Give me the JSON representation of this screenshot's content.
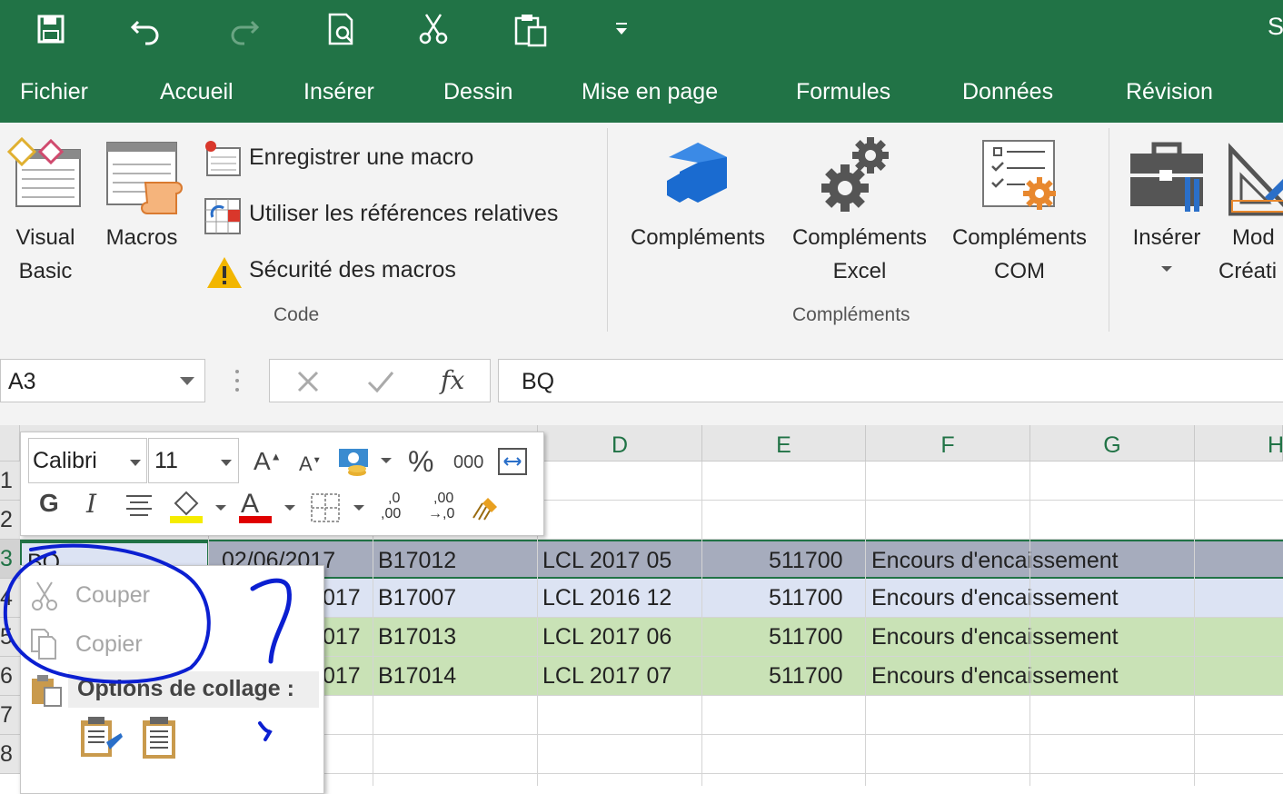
{
  "window": {
    "title_fragment": "S"
  },
  "ribbon_tabs": [
    "Fichier",
    "Accueil",
    "Insérer",
    "Dessin",
    "Mise en page",
    "Formules",
    "Données",
    "Révision"
  ],
  "ribbon": {
    "code_group": {
      "label": "Code",
      "visual_basic": [
        "Visual",
        "Basic"
      ],
      "macros": "Macros",
      "record_macro": "Enregistrer une macro",
      "relative_refs": "Utiliser les références relatives",
      "macro_security": "Sécurité des macros"
    },
    "addins_group": {
      "label": "Compléments",
      "addins": "Compléments",
      "excel_addins": [
        "Compléments",
        "Excel"
      ],
      "com_addins": [
        "Compléments",
        "COM"
      ]
    },
    "controls_group": {
      "insert": "Insérer",
      "design_mode": [
        "Mod",
        "Créati"
      ]
    }
  },
  "formula_bar": {
    "name_box": "A3",
    "fx": "fx",
    "formula": "BQ"
  },
  "columns": [
    "D",
    "E",
    "F",
    "G",
    "H"
  ],
  "rows": [
    {
      "num": "1",
      "cells": []
    },
    {
      "num": "2",
      "cells": []
    },
    {
      "num": "3",
      "a": "BQ",
      "b": "02/06/2017",
      "c": "B17012",
      "d": "LCL 2017 05",
      "e": "511700",
      "f": "Encours d'encaissement"
    },
    {
      "num": "4",
      "b": "017",
      "c": "B17007",
      "d": "LCL 2016 12",
      "e": "511700",
      "f": "Encours d'encaissement"
    },
    {
      "num": "5",
      "b": "017",
      "c": "B17013",
      "d": "LCL 2017 06",
      "e": "511700",
      "f": "Encours d'encaissement"
    },
    {
      "num": "6",
      "b": "017",
      "c": "B17014",
      "d": "LCL 2017 07",
      "e": "511700",
      "f": "Encours d'encaissement"
    },
    {
      "num": "7"
    },
    {
      "num": "8"
    }
  ],
  "mini_toolbar": {
    "font": "Calibri",
    "size": "11",
    "bold": "G",
    "italic": "I",
    "percent": "%",
    "thousands": "000",
    "inc_decimal": [
      ",0",
      ",00"
    ],
    "dec_decimal": [
      ",00",
      "→,0"
    ]
  },
  "context_menu": {
    "cut": "Couper",
    "copy": "Copier",
    "paste_options": "Options de collage :"
  },
  "colors": {
    "excel_green": "#217346",
    "row3_fill": "#a6acbd",
    "row4_fill": "#dce3f3",
    "row56_fill": "#c9e2b6",
    "scribble": "#0b1fd1"
  }
}
